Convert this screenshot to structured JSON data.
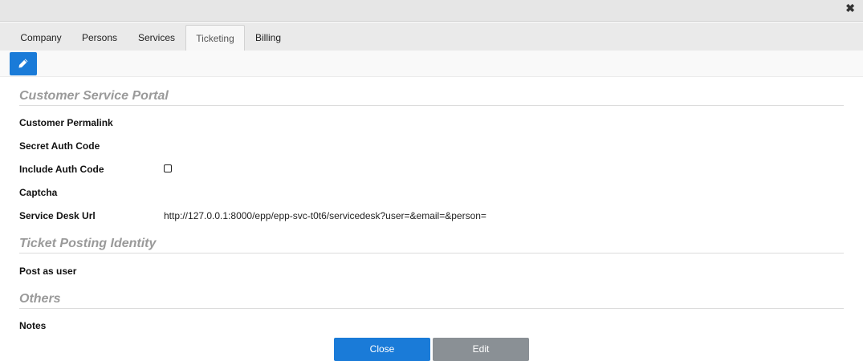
{
  "window": {
    "close_icon": "close-icon"
  },
  "tabs": [
    {
      "label": "Company",
      "active": false
    },
    {
      "label": "Persons",
      "active": false
    },
    {
      "label": "Services",
      "active": false
    },
    {
      "label": "Ticketing",
      "active": true
    },
    {
      "label": "Billing",
      "active": false
    }
  ],
  "toolbar": {
    "edit_icon": "pencil-icon",
    "accent": "#1a7bd8"
  },
  "sections": {
    "portal": {
      "title": "Customer Service Portal",
      "customer_permalink": {
        "label": "Customer Permalink",
        "value": ""
      },
      "secret_auth_code": {
        "label": "Secret Auth Code",
        "value": ""
      },
      "include_auth_code": {
        "label": "Include Auth Code",
        "checked": false
      },
      "captcha": {
        "label": "Captcha",
        "value": ""
      },
      "service_desk_url": {
        "label": "Service Desk Url",
        "value": "http://127.0.0.1:8000/epp/epp-svc-t0t6/servicedesk?user=&email=&person="
      }
    },
    "identity": {
      "title": "Ticket Posting Identity",
      "post_as_user": {
        "label": "Post as user",
        "value": ""
      }
    },
    "others": {
      "title": "Others",
      "notes": {
        "label": "Notes",
        "value": ""
      }
    }
  },
  "footer": {
    "close_label": "Close",
    "edit_label": "Edit"
  }
}
